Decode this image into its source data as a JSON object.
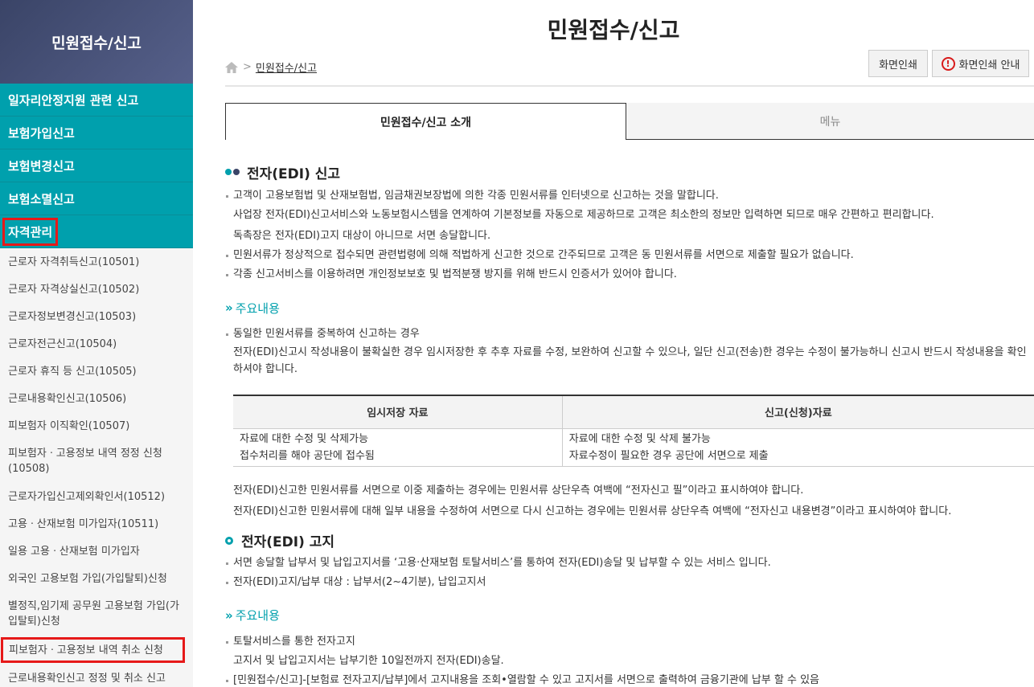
{
  "sidebar": {
    "title": "민원접수/신고",
    "categories": [
      "일자리안정지원 관련 신고",
      "보험가입신고",
      "보험변경신고",
      "보험소멸신고",
      "자격관리"
    ],
    "items": [
      "근로자 자격취득신고(10501)",
      "근로자 자격상실신고(10502)",
      "근로자정보변경신고(10503)",
      "근로자전근신고(10504)",
      "근로자 휴직 등 신고(10505)",
      "근로내용확인신고(10506)",
      "피보험자 이직확인(10507)",
      "피보험자ㆍ고용정보 내역 정정 신청(10508)",
      "근로자가입신고제외확인서(10512)",
      "고용ㆍ산재보험 미가입자(10511)",
      "일용 고용ㆍ산재보험 미가입자",
      "외국인 고용보험 가입(가입탈퇴)신청",
      "별정직,임기제 공무원 고용보험 가입(가입탈퇴)신청",
      "피보험자ㆍ고용정보 내역 취소 신청",
      "근로내용확인신고 정정 및 취소 신고"
    ]
  },
  "header": {
    "title": "민원접수/신고",
    "breadcrumb_sep": ">",
    "breadcrumb": "민원접수/신고",
    "print_label": "화면인쇄",
    "print_guide_label": "화면인쇄 안내",
    "alert_glyph": "!"
  },
  "tabs": [
    "민원접수/신고 소개",
    "메뉴"
  ],
  "section1": {
    "title": "전자(EDI) 신고",
    "lines": [
      "고객이 고용보험법 및 산재보험법, 임금채권보장법에 의한 각종 민원서류를 인터넷으로 신고하는 것을 말합니다.",
      "사업장 전자(EDI)신고서비스와 노동보험시스템을 연계하여 기본정보를 자동으로 제공하므로 고객은 최소한의 정보만 입력하면 되므로 매우 간편하고 편리합니다.",
      "독촉장은 전자(EDI)고지 대상이 아니므로 서면 송달합니다.",
      "민원서류가 정상적으로 접수되면 관련법령에 의해 적법하게 신고한 것으로 간주되므로 고객은 동 민원서류를 서면으로 제출할 필요가 없습니다.",
      "각종 신고서비스를 이용하려면 개인정보보호 및 법적분쟁 방지를 위해 반드시 인증서가 있어야 합니다."
    ],
    "sub_title": "주요내용",
    "sub_arrow": "»",
    "sub_lines": [
      "동일한 민원서류를 중복하여 신고하는 경우",
      "전자(EDI)신고시 작성내용이 불확실한 경우 임시저장한 후 추후 자료를 수정, 보완하여 신고할 수 있으나, 일단 신고(전송)한 경우는 수정이 불가능하니 신고시 반드시 작성내용을 확인하셔야 합니다."
    ],
    "table": {
      "headers": [
        "임시저장 자료",
        "신고(신청)자료"
      ],
      "rows": [
        [
          "자료에 대한 수정 및 삭제가능",
          "자료에 대한 수정 및 삭제 불가능"
        ],
        [
          "접수처리를 해야 공단에 접수됨",
          "자료수정이 필요한 경우 공단에 서면으로 제출"
        ]
      ]
    },
    "after_lines": [
      "전자(EDI)신고한 민원서류를 서면으로 이중 제출하는 경우에는 민원서류 상단우측 여백에 “전자신고 필”이라고 표시하여야 합니다.",
      "전자(EDI)신고한 민원서류에 대해 일부 내용을 수정하여 서면으로 다시 신고하는 경우에는 민원서류 상단우측 여백에 “전자신고 내용변경”이라고 표시하여야 합니다."
    ]
  },
  "section2": {
    "title": "전자(EDI) 고지",
    "lines": [
      "서면 송달할 납부서 및 납입고지서를 ‘고용·산재보험 토탈서비스’를 통하여 전자(EDI)송달 및 납부할 수 있는 서비스 입니다.",
      "전자(EDI)고지/납부 대상 : 납부서(2~4기분), 납입고지서"
    ],
    "sub_title": "주요내용",
    "sub_arrow": "»",
    "sub_lines": [
      "토탈서비스를 통한 전자고지",
      "고지서 및 납입고지서는 납부기한 10일전까지 전자(EDI)송달.",
      "[민원접수/신고]-[보험료 전자고지/납부]에서 고지내용을 조회•열람할 수 있고 고지서를 서면으로 출력하여 금융기관에 납부 할 수 있음"
    ]
  },
  "colors": {
    "teal": "#00a0ad",
    "highlight": "#e61919",
    "header_bg": "#3a4467"
  }
}
